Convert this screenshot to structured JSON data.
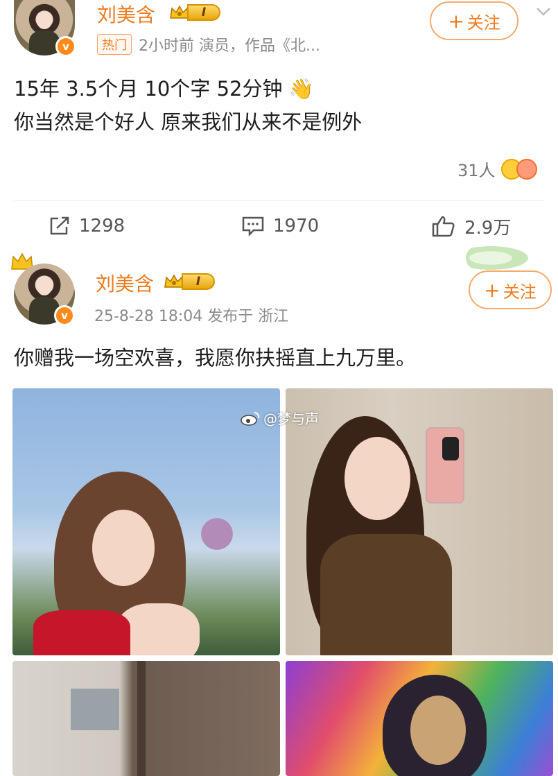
{
  "post1": {
    "author": "刘美含",
    "level": "I",
    "verified_mark": "v",
    "follow": {
      "plus": "+",
      "label": "关注"
    },
    "hot_badge": "热门",
    "meta": "2小时前  演员，作品《北...",
    "content_lines": [
      "15年 3.5个月 10个字 52分钟 👋",
      "你当然是个好人   原来我们从来不是例外"
    ],
    "reactors_count": "31人",
    "actions": {
      "share": "1298",
      "comment": "1970",
      "like": "2.9万"
    }
  },
  "post2": {
    "author": "刘美含",
    "level": "I",
    "verified_mark": "v",
    "follow": {
      "plus": "+",
      "label": "关注"
    },
    "meta": "25-8-28 18:04   发布于 浙江",
    "content": "你赠我一场空欢喜，我愿你扶摇直上九万里。",
    "watermark": "@梦与声"
  },
  "colors": {
    "accent": "#f07b1d",
    "follow_border": "#f7a96a",
    "meta_gray": "#8a8a8a"
  },
  "icons": [
    "chevron-down-icon",
    "share-icon",
    "comment-icon",
    "like-icon",
    "crown-icon",
    "weibo-logo-icon",
    "verified-icon"
  ]
}
